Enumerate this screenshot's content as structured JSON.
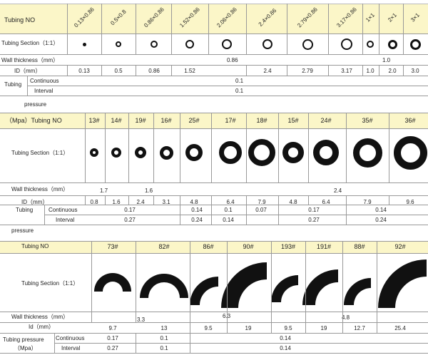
{
  "t1": {
    "tubing_no": "Tubing NO",
    "sizes": [
      "0.13×0.86",
      "0.5×0.8",
      "0.86×0.86",
      "1.52×0.86",
      "2.06×0.86",
      "2.4×0.86",
      "2.79×0.86",
      "3.17×0.86",
      "1×1",
      "2×1",
      "3×1"
    ],
    "section": "Tubing Section（1:1）",
    "wall": "Wall thickness（mm）",
    "wall_a": "0.86",
    "wall_b": "1.0",
    "id_label": "ID（mm）",
    "ids": [
      "0.13",
      "0.5",
      "0.86",
      "1.52",
      "",
      "2.4",
      "2.79",
      "3.17",
      "1.0",
      "2.0",
      "3.0"
    ],
    "tubing": "Tubing",
    "continuous": "Continuous",
    "interval": "Interval",
    "cont_val": "0.1",
    "int_val": "0.1",
    "pressure": "pressure"
  },
  "t2": {
    "header": "（Mpa）Tubing NO",
    "nos": [
      "13#",
      "14#",
      "19#",
      "16#",
      "25#",
      "17#",
      "18#",
      "15#",
      "24#",
      "35#",
      "36#"
    ],
    "section": "Tubing Section（1:1）",
    "wall": "Wall thickness（mm）",
    "wall_a": "1.7",
    "wall_b": "1.6",
    "wall_c": "2.4",
    "id_label": "ID（mm）",
    "ids": [
      "0.8",
      "1.6",
      "2.4",
      "3.1",
      "4.8",
      "6.4",
      "7.9",
      "4.8",
      "6.4",
      "7.9",
      "9.6"
    ],
    "tubing": "Tubing",
    "continuous": "Continuous",
    "interval": "Interval",
    "cont": [
      "0.17",
      "0.14",
      "0.1",
      "0.07",
      "0.17",
      "0.14"
    ],
    "int": [
      "0.27",
      "0.24",
      "0.14",
      "0.27",
      "0.24"
    ],
    "pressure": "pressure"
  },
  "t3": {
    "tubing_no": "Tubing NO",
    "nos": [
      "73#",
      "82#",
      "86#",
      "90#",
      "193#",
      "191#",
      "88#",
      "92#"
    ],
    "section": "Tubing Section（1:1）",
    "wall": "Wall thickness（mm）",
    "wall_a": "3.3",
    "wall_b": "6.3",
    "wall_c": "4.8",
    "id_label": "Id（mm）",
    "ids": [
      "9.7",
      "13",
      "9.5",
      "19",
      "9.5",
      "19",
      "12.7",
      "25.4"
    ],
    "tubing_pressure": "Tubing pressure",
    "mpa": "（Mpa）",
    "continuous": "Continuous",
    "interval": "Interval",
    "cont": [
      "0.17",
      "0.1",
      "0.14"
    ],
    "int": [
      "0.27",
      "0.1",
      "0.14"
    ]
  }
}
